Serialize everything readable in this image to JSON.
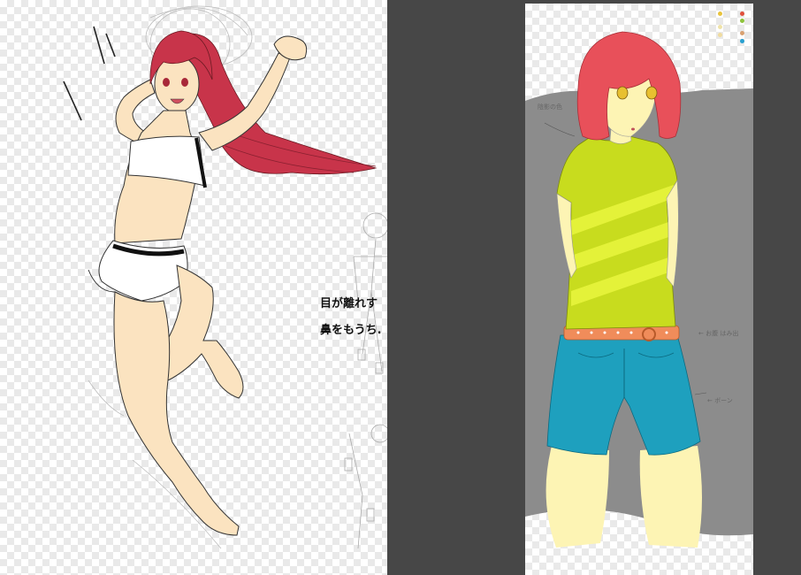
{
  "left_canvas": {
    "memo_line_1": "目が離れす",
    "memo_line_2": "鼻をもうち."
  },
  "right_canvas": {
    "note_top": "陰影の色",
    "note_belt": "← お腹 はみ出",
    "note_shorts": "← ボーン",
    "palette": [
      "#e8c33c",
      "#e0503c",
      "#efe3a8",
      "#8ec33c",
      "#f0dca0",
      "#d8a070",
      "#28a0d0"
    ]
  },
  "colors": {
    "background": "#474747",
    "hair": "#c8344a",
    "hair_right": "#e8505a",
    "skin": "#fbe3c0",
    "skin_right": "#fdf4b4",
    "shirt": "#c8dc1e",
    "shorts": "#1ea0be",
    "belt": "#f08c5a"
  }
}
